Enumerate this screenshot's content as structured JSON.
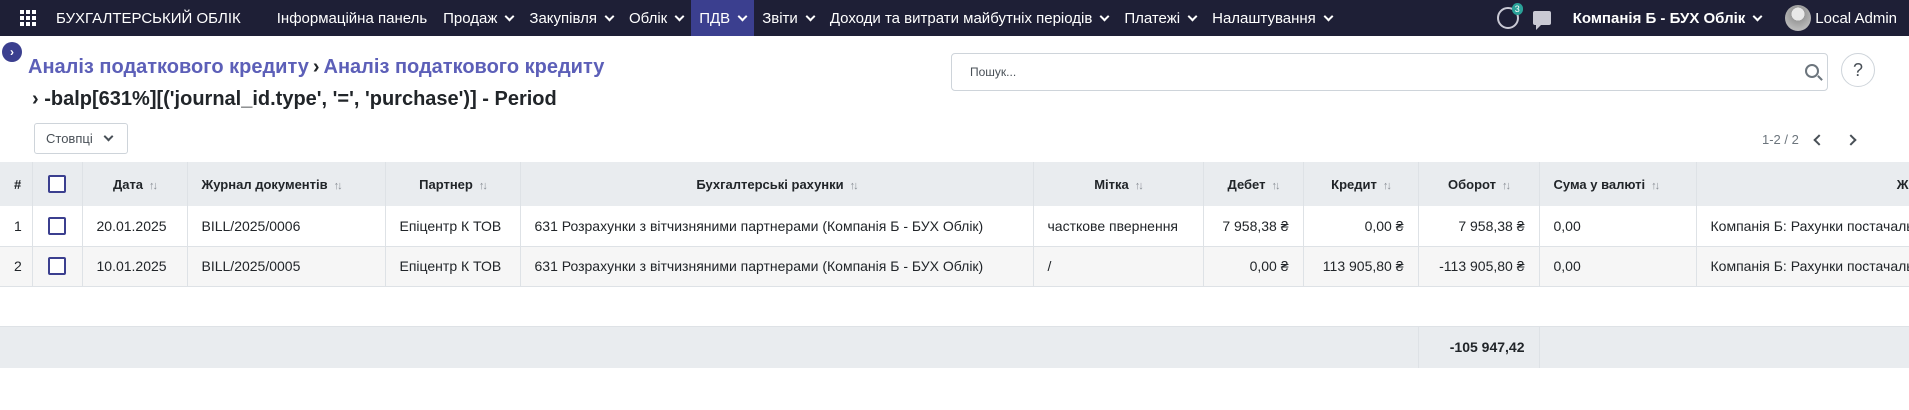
{
  "topbar": {
    "brand": "БУХГАЛТЕРСЬКИЙ ОБЛІК",
    "menu": [
      {
        "label": "Інформаційна панель",
        "dropdown": false
      },
      {
        "label": "Продаж",
        "dropdown": true
      },
      {
        "label": "Закупівля",
        "dropdown": true
      },
      {
        "label": "Облік",
        "dropdown": true
      },
      {
        "label": "ПДВ",
        "dropdown": true,
        "active": true
      },
      {
        "label": "Звіти",
        "dropdown": true
      },
      {
        "label": "Доходи та витрати майбутніх періодів",
        "dropdown": true
      },
      {
        "label": "Платежі",
        "dropdown": true
      },
      {
        "label": "Налаштування",
        "dropdown": true
      }
    ],
    "activity_badge": "3",
    "company": "Компанія Б - БУХ Облік",
    "user": "Local Admin",
    "active_color": "#3b3f8f",
    "bar_color": "#1e1f36"
  },
  "control": {
    "breadcrumb_1": "Аналіз податкового кредиту",
    "breadcrumb_2": "Аналіз податкового кредиту",
    "title": "-balp[631%][('journal_id.type', '=', 'purchase')] - Period",
    "search_placeholder": "Пошук...",
    "help": "?",
    "columns_label": "Стовпці",
    "pager": "1-2 / 2"
  },
  "table": {
    "headers": {
      "idx": "#",
      "date": "Дата",
      "journal": "Журнал документів",
      "partner": "Партнер",
      "account": "Бухгалтерські рахунки",
      "label": "Мітка",
      "debit": "Дебет",
      "credit": "Кредит",
      "balance": "Оборот",
      "amount_currency": "Сума у валюті",
      "last": "Ж"
    },
    "rows": [
      {
        "idx": "1",
        "date": "20.01.2025",
        "journal": "BILL/2025/0006",
        "partner": "Епіцентр К ТОВ",
        "account": "631 Розрахунки з вітчизняними партнерами (Компанія Б - БУХ Облік)",
        "label": "часткове пвернення",
        "debit": "7 958,38 ₴",
        "credit": "0,00 ₴",
        "balance": "7 958,38 ₴",
        "amount_currency": "0,00",
        "journal_name": "Компанія Б: Рахунки постачальників"
      },
      {
        "idx": "2",
        "date": "10.01.2025",
        "journal": "BILL/2025/0005",
        "partner": "Епіцентр К ТОВ",
        "account": "631 Розрахунки з вітчизняними партнерами (Компанія Б - БУХ Облік)",
        "label": "/",
        "debit": "0,00 ₴",
        "credit": "113 905,80 ₴",
        "balance": "-113 905,80 ₴",
        "amount_currency": "0,00",
        "journal_name": "Компанія Б: Рахунки постачальників"
      }
    ],
    "total_balance": "-105 947,42"
  }
}
